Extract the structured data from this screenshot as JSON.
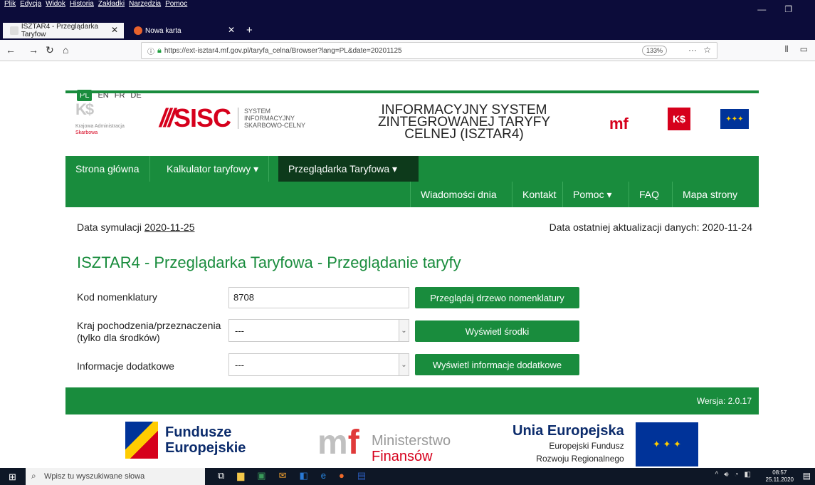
{
  "browser": {
    "menu": [
      "Plik",
      "Edycja",
      "Widok",
      "Historia",
      "Zakładki",
      "Narzędzia",
      "Pomoc"
    ],
    "tabs": [
      {
        "label": "ISZTAR4 - Przeglądarka Taryfow"
      },
      {
        "label": "Nowa karta"
      }
    ],
    "url": "https://ext-isztar4.mf.gov.pl/taryfa_celna/Browser?lang=PL&date=20201125",
    "zoom": "133%"
  },
  "languages": [
    "PL",
    "EN",
    "FR",
    "DE"
  ],
  "header": {
    "kas_line1": "Krajowa Administracja",
    "kas_line2": "Skarbowa",
    "sisc_word": "SISC",
    "sisc_sub": [
      "SYSTEM",
      "INFORMACYJNY",
      "SKARBOWO-CELNY"
    ],
    "system_title": [
      "INFORMACYJNY SYSTEM",
      "ZINTEGROWANEJ TARYFY",
      "CELNEJ (ISZTAR4)"
    ]
  },
  "nav": {
    "row1": [
      "Strona główna",
      "Kalkulator taryfowy ▾",
      "Przeglądarka Taryfowa ▾"
    ],
    "row2": [
      "Wiadomości dnia",
      "Kontakt",
      "Pomoc ▾",
      "FAQ",
      "Mapa strony"
    ]
  },
  "info": {
    "sim_label": "Data symulacji",
    "sim_date": "2020-11-25",
    "updated": "Data ostatniej aktualizacji danych: 2020-11-24"
  },
  "page_title": "ISZTAR4 - Przeglądarka Taryfowa - Przeglądanie taryfy",
  "form": {
    "nomenclature_label": "Kod nomenklatury",
    "nomenclature_value": "8708",
    "nomenclature_button": "Przeglądaj drzewo nomenklatury",
    "country_label_1": "Kraj pochodzenia/przeznaczenia",
    "country_label_2": "(tylko dla środków)",
    "country_value": "---",
    "country_button": "Wyświetl środki",
    "additional_label": "Informacje dodatkowe",
    "additional_value": "---",
    "additional_button": "Wyświetl informacje dodatkowe"
  },
  "version": "Wersja: 2.0.17",
  "logos": {
    "funds": [
      "Fundusze",
      "Europejskie"
    ],
    "mf": [
      "Ministerstwo",
      "Finansów"
    ],
    "ue_title": "Unia Europejska",
    "ue_sub": [
      "Europejski Fundusz",
      "Rozwoju Regionalnego"
    ]
  },
  "taskbar": {
    "search_placeholder": "Wpisz tu wyszukiwane słowa",
    "time": "08:57",
    "date": "25.11.2020"
  },
  "colors": {
    "accent_green": "#198c3d",
    "brand_red": "#d6001c",
    "eu_blue": "#003399"
  }
}
